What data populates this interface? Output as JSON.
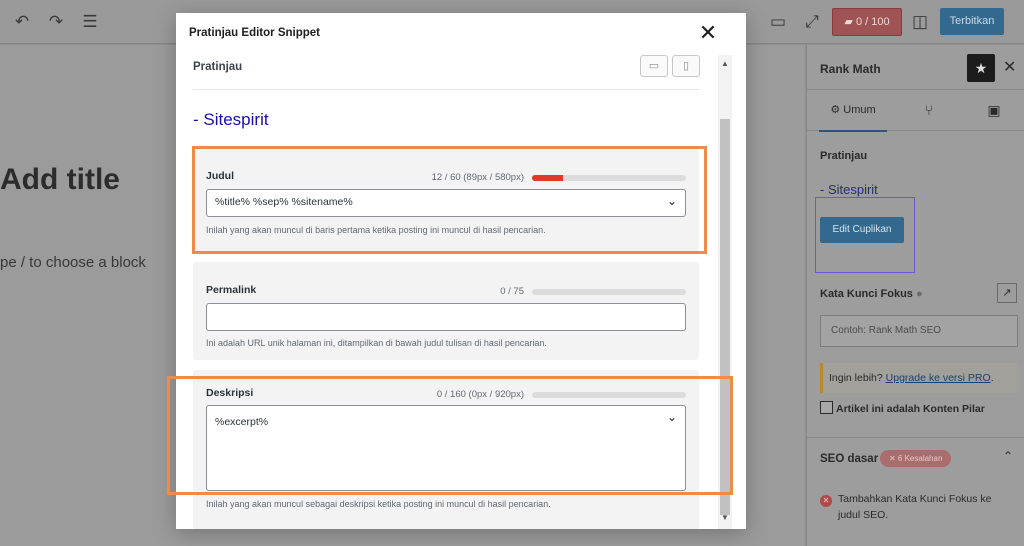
{
  "topbar": {
    "score": "0 / 100",
    "publish_label": "Terbitkan"
  },
  "editor": {
    "title_placeholder": "Add title",
    "block_hint": "pe / to choose a block"
  },
  "sidebar": {
    "title": "Rank Math",
    "tab_general": "Umum",
    "preview_label": "Pratinjau",
    "site_name": "- Sitespirit",
    "edit_snippet_label": "Edit Cuplikan",
    "focus_keyword_label": "Kata Kunci Fokus",
    "focus_keyword_placeholder": "Contoh: Rank Math SEO",
    "upgrade_prefix": "Ingin lebih? ",
    "upgrade_link": "Upgrade ke versi PRO",
    "upgrade_suffix": ".",
    "pillar_content_label": "Artikel ini adalah Konten Pilar",
    "basic_seo_label": "SEO dasar",
    "errors_badge": "✕ 6 Kesalahan",
    "check_item": "Tambahkan Kata Kunci Fokus ke judul SEO."
  },
  "modal": {
    "title": "Pratinjau Editor Snippet",
    "preview_label": "Pratinjau",
    "preview_site": "- Sitespirit",
    "title_field": {
      "label": "Judul",
      "counter": "12 / 60 (89px / 580px)",
      "progress": 0.2,
      "value": "%title% %sep% %sitename%",
      "help": "Inilah yang akan muncul di baris pertama ketika posting ini muncul di hasil pencarian."
    },
    "permalink_field": {
      "label": "Permalink",
      "counter": "0 / 75",
      "progress": 0,
      "value": "",
      "help": "Ini adalah URL unik halaman ini, ditampilkan di bawah judul tulisan di hasil pencarian."
    },
    "description_field": {
      "label": "Deskripsi",
      "counter": "0 / 160 (0px / 920px)",
      "progress": 0,
      "value": "%excerpt%",
      "help": "Inilah yang akan muncul sebagai deskripsi ketika posting ini muncul di hasil pencarian."
    }
  },
  "colors": {
    "accent": "#2271b1",
    "highlight": "#ef8a4a",
    "error": "#e2382a",
    "link": "#1a0dab"
  },
  "icons": [
    "undo-icon",
    "redo-icon",
    "list-view-icon",
    "desktop-icon",
    "fullscreen-icon",
    "rank-math-icon",
    "sidebar-toggle-icon",
    "star-icon",
    "close-icon",
    "gear-icon",
    "social-icon",
    "schema-icon",
    "trend-icon",
    "chevron-up-icon",
    "error-icon",
    "help-icon",
    "mobile-icon",
    "chevron-down-icon"
  ]
}
